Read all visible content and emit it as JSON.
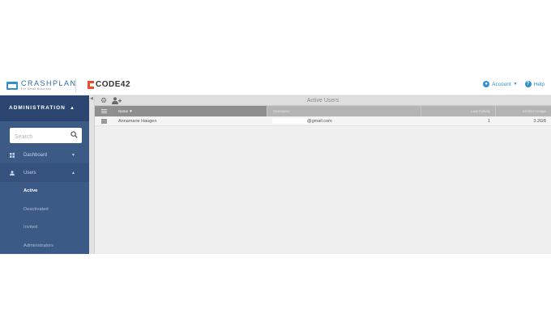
{
  "header": {
    "brand_name": "CRASHPLAN",
    "brand_tagline": "For Small Business",
    "partner_name": "CODE42",
    "account_label": "Account",
    "help_label": "Help"
  },
  "sidebar": {
    "section_title": "ADMINISTRATION",
    "search_placeholder": "Search",
    "items": [
      {
        "label": "Dashboard",
        "icon": "dashboard-icon"
      },
      {
        "label": "Users",
        "icon": "user-icon"
      }
    ],
    "users_subitems": [
      "Active",
      "Deactivated",
      "Invited",
      "Administrators"
    ],
    "active_subitem": "Active"
  },
  "toolbar": {
    "title": "Active Users",
    "icons": [
      "gear-icon",
      "add-user-icon"
    ]
  },
  "table": {
    "columns": [
      "Name",
      "Username",
      "Last Activity",
      "Archive Usage"
    ],
    "sort_indicator": "▼",
    "rows": [
      {
        "name": "Annamarie Haugen",
        "username_visible": "@gmail.com",
        "last_activity": "1",
        "archive_usage": "3.2GB"
      }
    ]
  },
  "colors": {
    "accent": "#2f8fd0",
    "sidebar_bg": "#3c5a86",
    "sidebar_header_bg": "#2a4670",
    "code42_red": "#e8502d"
  }
}
